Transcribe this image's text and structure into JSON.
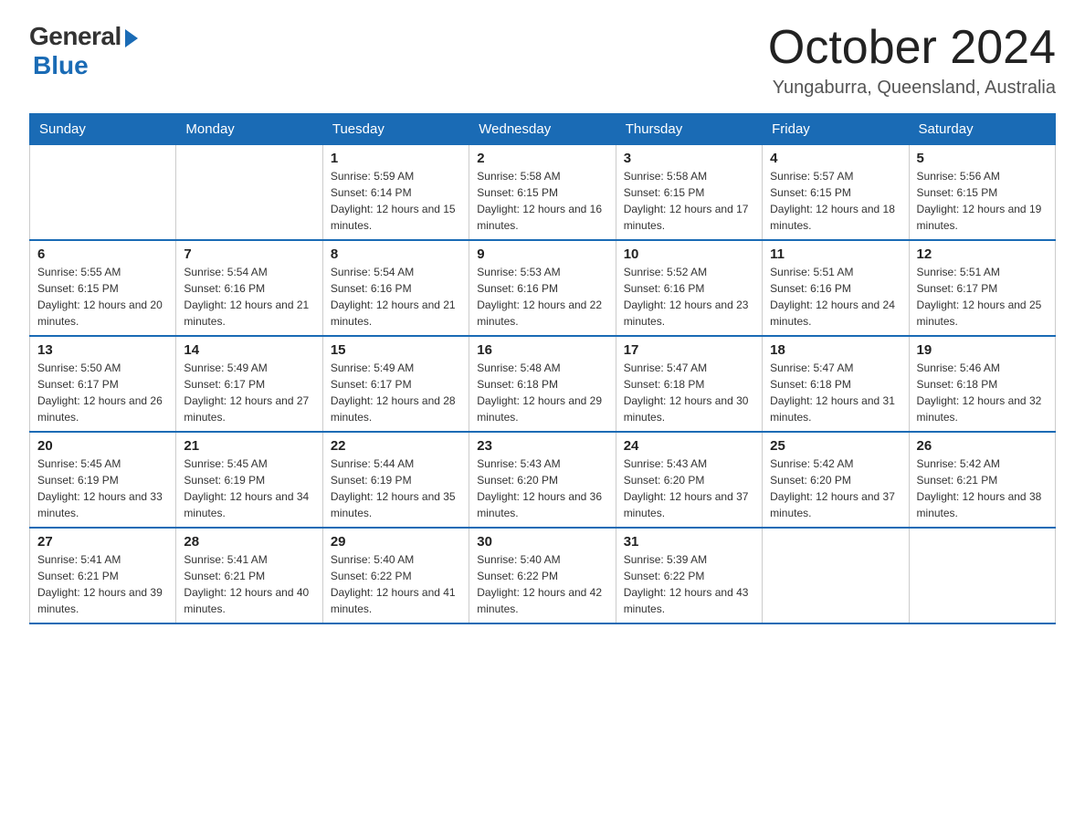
{
  "logo": {
    "general": "General",
    "blue": "Blue"
  },
  "title": "October 2024",
  "location": "Yungaburra, Queensland, Australia",
  "days_of_week": [
    "Sunday",
    "Monday",
    "Tuesday",
    "Wednesday",
    "Thursday",
    "Friday",
    "Saturday"
  ],
  "weeks": [
    [
      {
        "day": "",
        "sunrise": "",
        "sunset": "",
        "daylight": ""
      },
      {
        "day": "",
        "sunrise": "",
        "sunset": "",
        "daylight": ""
      },
      {
        "day": "1",
        "sunrise": "Sunrise: 5:59 AM",
        "sunset": "Sunset: 6:14 PM",
        "daylight": "Daylight: 12 hours and 15 minutes."
      },
      {
        "day": "2",
        "sunrise": "Sunrise: 5:58 AM",
        "sunset": "Sunset: 6:15 PM",
        "daylight": "Daylight: 12 hours and 16 minutes."
      },
      {
        "day": "3",
        "sunrise": "Sunrise: 5:58 AM",
        "sunset": "Sunset: 6:15 PM",
        "daylight": "Daylight: 12 hours and 17 minutes."
      },
      {
        "day": "4",
        "sunrise": "Sunrise: 5:57 AM",
        "sunset": "Sunset: 6:15 PM",
        "daylight": "Daylight: 12 hours and 18 minutes."
      },
      {
        "day": "5",
        "sunrise": "Sunrise: 5:56 AM",
        "sunset": "Sunset: 6:15 PM",
        "daylight": "Daylight: 12 hours and 19 minutes."
      }
    ],
    [
      {
        "day": "6",
        "sunrise": "Sunrise: 5:55 AM",
        "sunset": "Sunset: 6:15 PM",
        "daylight": "Daylight: 12 hours and 20 minutes."
      },
      {
        "day": "7",
        "sunrise": "Sunrise: 5:54 AM",
        "sunset": "Sunset: 6:16 PM",
        "daylight": "Daylight: 12 hours and 21 minutes."
      },
      {
        "day": "8",
        "sunrise": "Sunrise: 5:54 AM",
        "sunset": "Sunset: 6:16 PM",
        "daylight": "Daylight: 12 hours and 21 minutes."
      },
      {
        "day": "9",
        "sunrise": "Sunrise: 5:53 AM",
        "sunset": "Sunset: 6:16 PM",
        "daylight": "Daylight: 12 hours and 22 minutes."
      },
      {
        "day": "10",
        "sunrise": "Sunrise: 5:52 AM",
        "sunset": "Sunset: 6:16 PM",
        "daylight": "Daylight: 12 hours and 23 minutes."
      },
      {
        "day": "11",
        "sunrise": "Sunrise: 5:51 AM",
        "sunset": "Sunset: 6:16 PM",
        "daylight": "Daylight: 12 hours and 24 minutes."
      },
      {
        "day": "12",
        "sunrise": "Sunrise: 5:51 AM",
        "sunset": "Sunset: 6:17 PM",
        "daylight": "Daylight: 12 hours and 25 minutes."
      }
    ],
    [
      {
        "day": "13",
        "sunrise": "Sunrise: 5:50 AM",
        "sunset": "Sunset: 6:17 PM",
        "daylight": "Daylight: 12 hours and 26 minutes."
      },
      {
        "day": "14",
        "sunrise": "Sunrise: 5:49 AM",
        "sunset": "Sunset: 6:17 PM",
        "daylight": "Daylight: 12 hours and 27 minutes."
      },
      {
        "day": "15",
        "sunrise": "Sunrise: 5:49 AM",
        "sunset": "Sunset: 6:17 PM",
        "daylight": "Daylight: 12 hours and 28 minutes."
      },
      {
        "day": "16",
        "sunrise": "Sunrise: 5:48 AM",
        "sunset": "Sunset: 6:18 PM",
        "daylight": "Daylight: 12 hours and 29 minutes."
      },
      {
        "day": "17",
        "sunrise": "Sunrise: 5:47 AM",
        "sunset": "Sunset: 6:18 PM",
        "daylight": "Daylight: 12 hours and 30 minutes."
      },
      {
        "day": "18",
        "sunrise": "Sunrise: 5:47 AM",
        "sunset": "Sunset: 6:18 PM",
        "daylight": "Daylight: 12 hours and 31 minutes."
      },
      {
        "day": "19",
        "sunrise": "Sunrise: 5:46 AM",
        "sunset": "Sunset: 6:18 PM",
        "daylight": "Daylight: 12 hours and 32 minutes."
      }
    ],
    [
      {
        "day": "20",
        "sunrise": "Sunrise: 5:45 AM",
        "sunset": "Sunset: 6:19 PM",
        "daylight": "Daylight: 12 hours and 33 minutes."
      },
      {
        "day": "21",
        "sunrise": "Sunrise: 5:45 AM",
        "sunset": "Sunset: 6:19 PM",
        "daylight": "Daylight: 12 hours and 34 minutes."
      },
      {
        "day": "22",
        "sunrise": "Sunrise: 5:44 AM",
        "sunset": "Sunset: 6:19 PM",
        "daylight": "Daylight: 12 hours and 35 minutes."
      },
      {
        "day": "23",
        "sunrise": "Sunrise: 5:43 AM",
        "sunset": "Sunset: 6:20 PM",
        "daylight": "Daylight: 12 hours and 36 minutes."
      },
      {
        "day": "24",
        "sunrise": "Sunrise: 5:43 AM",
        "sunset": "Sunset: 6:20 PM",
        "daylight": "Daylight: 12 hours and 37 minutes."
      },
      {
        "day": "25",
        "sunrise": "Sunrise: 5:42 AM",
        "sunset": "Sunset: 6:20 PM",
        "daylight": "Daylight: 12 hours and 37 minutes."
      },
      {
        "day": "26",
        "sunrise": "Sunrise: 5:42 AM",
        "sunset": "Sunset: 6:21 PM",
        "daylight": "Daylight: 12 hours and 38 minutes."
      }
    ],
    [
      {
        "day": "27",
        "sunrise": "Sunrise: 5:41 AM",
        "sunset": "Sunset: 6:21 PM",
        "daylight": "Daylight: 12 hours and 39 minutes."
      },
      {
        "day": "28",
        "sunrise": "Sunrise: 5:41 AM",
        "sunset": "Sunset: 6:21 PM",
        "daylight": "Daylight: 12 hours and 40 minutes."
      },
      {
        "day": "29",
        "sunrise": "Sunrise: 5:40 AM",
        "sunset": "Sunset: 6:22 PM",
        "daylight": "Daylight: 12 hours and 41 minutes."
      },
      {
        "day": "30",
        "sunrise": "Sunrise: 5:40 AM",
        "sunset": "Sunset: 6:22 PM",
        "daylight": "Daylight: 12 hours and 42 minutes."
      },
      {
        "day": "31",
        "sunrise": "Sunrise: 5:39 AM",
        "sunset": "Sunset: 6:22 PM",
        "daylight": "Daylight: 12 hours and 43 minutes."
      },
      {
        "day": "",
        "sunrise": "",
        "sunset": "",
        "daylight": ""
      },
      {
        "day": "",
        "sunrise": "",
        "sunset": "",
        "daylight": ""
      }
    ]
  ]
}
